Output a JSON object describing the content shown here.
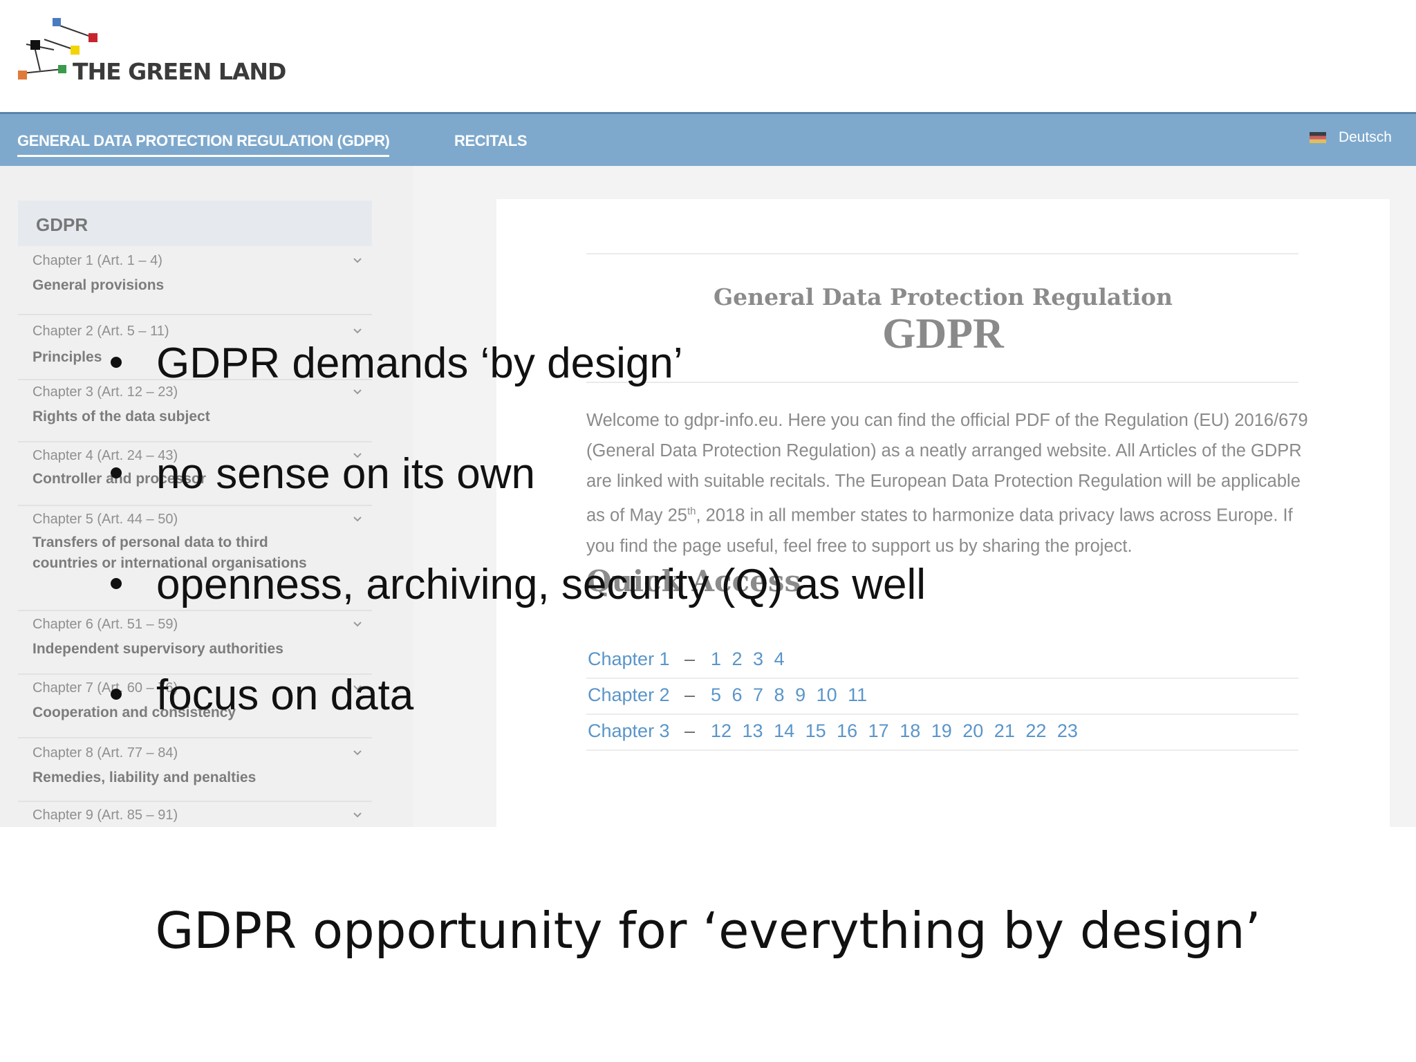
{
  "logo": {
    "text": "THE GREEN LAND"
  },
  "topnav": {
    "gdpr": "GENERAL DATA PROTECTION REGULATION (GDPR)",
    "recitals": "RECITALS",
    "language": "Deutsch"
  },
  "sidebar": {
    "heading": "GDPR",
    "chapters": [
      {
        "num": "Chapter 1 (Art. 1 – 4)",
        "title": "General provisions"
      },
      {
        "num": "Chapter 2 (Art. 5 – 11)",
        "title": "Principles"
      },
      {
        "num": "Chapter 3 (Art. 12 – 23)",
        "title": "Rights of the data subject"
      },
      {
        "num": "Chapter 4 (Art. 24 – 43)",
        "title": "Controller and processor"
      },
      {
        "num": "Chapter 5 (Art. 44 – 50)",
        "title": "Transfers of personal data to third countries or international organisations"
      },
      {
        "num": "Chapter 6 (Art. 51 – 59)",
        "title": "Independent supervisory authorities"
      },
      {
        "num": "Chapter 7 (Art. 60 – 76)",
        "title": "Cooperation and consistency"
      },
      {
        "num": "Chapter 8 (Art. 77 – 84)",
        "title": "Remedies, liability and penalties"
      },
      {
        "num": "Chapter 9 (Art. 85 – 91)",
        "title": ""
      }
    ]
  },
  "main": {
    "subtitle": "General Data Protection Regulation",
    "title": "GDPR",
    "intro_part1": "Welcome to gdpr-info.eu. Here you can find the official PDF of the Regulation (EU) 2016/679 (General Data Protection Regulation) as a neatly arranged website. All Articles of the GDPR are linked with suitable recitals. The European Data Protection Regulation will be applicable as of May 25",
    "intro_sup": "th",
    "intro_part2": ", 2018 in all member states to harmonize data privacy laws across Europe. If you find the page useful, feel free to support us by sharing the project.",
    "quick_access": "Quick Access",
    "quick_rows": [
      {
        "chapter": "Chapter 1",
        "dash": "–",
        "articles": "1 2 3 4"
      },
      {
        "chapter": "Chapter 2",
        "dash": "–",
        "articles": "5 6 7 8 9 10 11"
      },
      {
        "chapter": "Chapter 3",
        "dash": "–",
        "articles": "12 13 14 15 16 17 18 19 20 21 22 23"
      }
    ]
  },
  "slide": {
    "bullets": [
      "GDPR demands ‘by design’",
      "no sense on its own",
      "openness, archiving, security (Q) as well",
      "focus on data"
    ],
    "caption": "GDPR opportunity for ‘everything by design’"
  }
}
